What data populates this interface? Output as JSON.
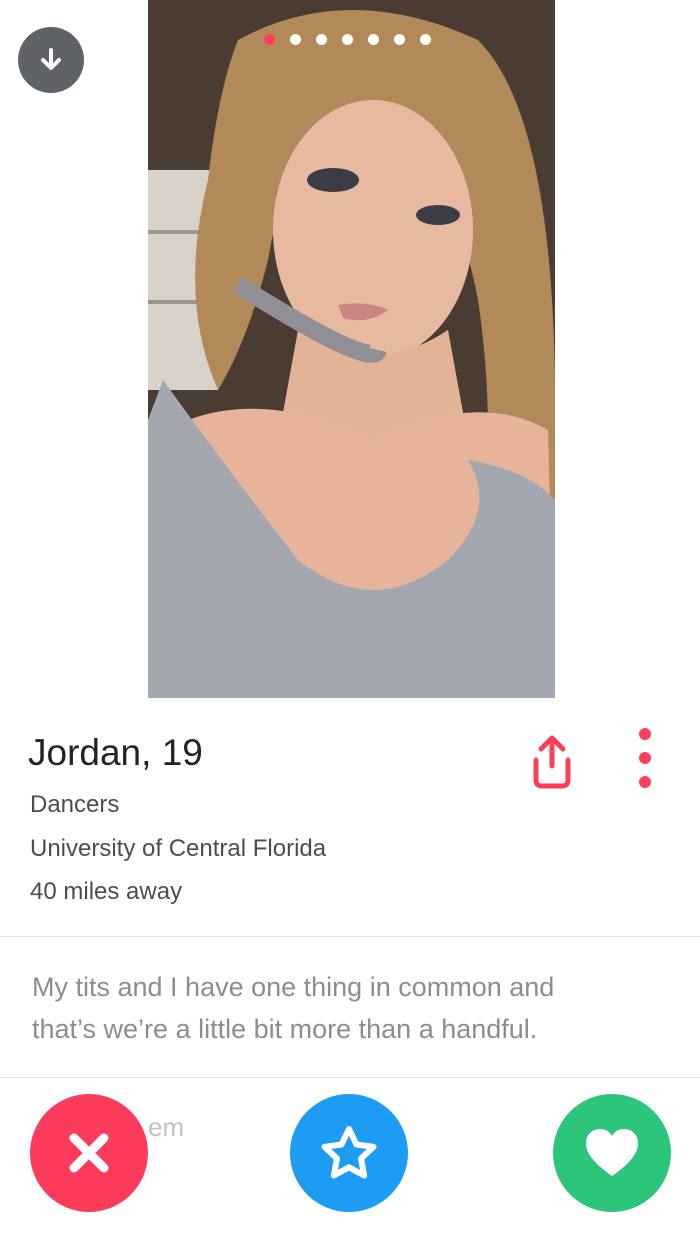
{
  "profile": {
    "name": "Jordan,",
    "age": "19",
    "job": "Dancers",
    "school": "University of Central Florida",
    "distance": "40 miles away",
    "bio_line1": "My tits and I have one thing in common and",
    "bio_line2": "that’s we’re a little bit more than a handful."
  },
  "photo_carousel": {
    "total": 7,
    "active_index": 0
  },
  "ghost_text": "em",
  "icons": {
    "collapse": "arrow-down-icon",
    "share": "share-icon",
    "more": "more-vertical-icon",
    "nope": "x-icon",
    "superlike": "star-icon",
    "like": "heart-icon"
  },
  "colors": {
    "accent": "#fd3e5b",
    "nope": "#fd3b5a",
    "superlike": "#1d9cf3",
    "like": "#2bc57b"
  }
}
